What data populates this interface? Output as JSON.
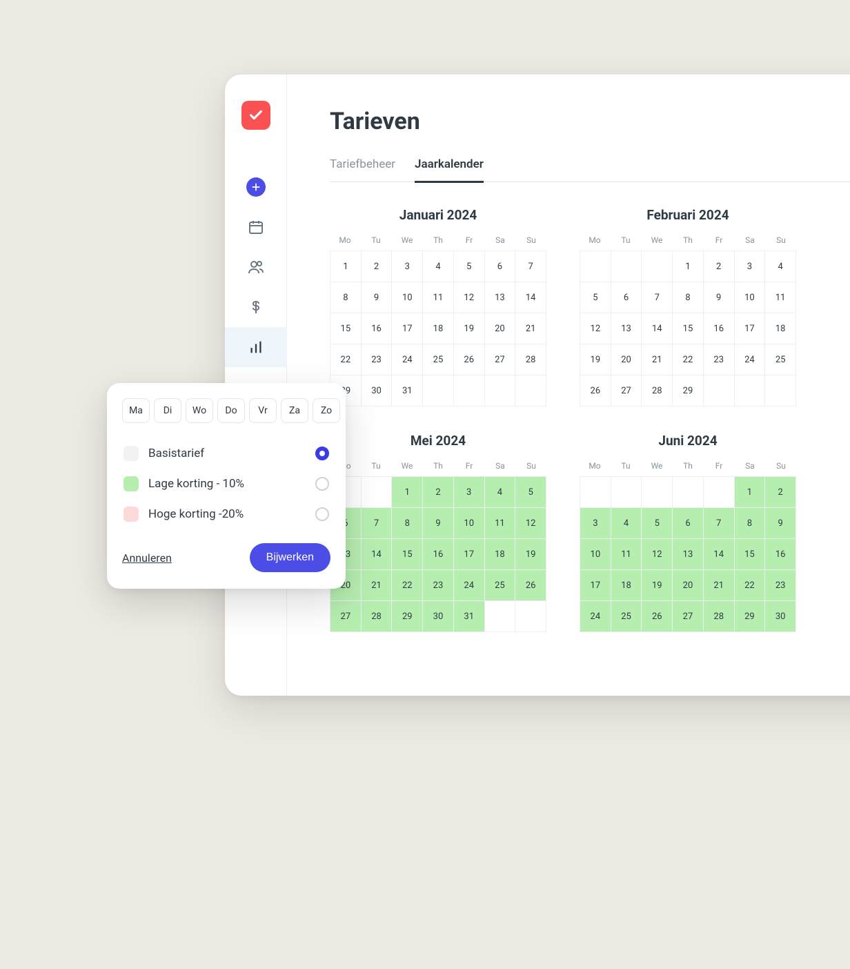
{
  "page_title": "Tarieven",
  "tabs": [
    {
      "label": "Tariefbeheer",
      "active": false
    },
    {
      "label": "Jaarkalender",
      "active": true
    }
  ],
  "weekday_short": [
    "Mo",
    "Tu",
    "We",
    "Th",
    "Fr",
    "Sa",
    "Su"
  ],
  "months": {
    "jan": {
      "title": "Januari 2024",
      "lead_blanks": 0,
      "days": 31,
      "green_from": 0
    },
    "feb": {
      "title": "Februari 2024",
      "lead_blanks": 3,
      "days": 29,
      "green_from": 0
    },
    "mei": {
      "title": "Mei 2024",
      "lead_blanks": 2,
      "days": 31,
      "green_from": 1
    },
    "juni": {
      "title": "Juni 2024",
      "lead_blanks": 5,
      "days": 30,
      "green_from": 1
    }
  },
  "popup": {
    "day_buttons": [
      "Ma",
      "Di",
      "Wo",
      "Do",
      "Vr",
      "Za",
      "Zo"
    ],
    "options": [
      {
        "label": "Basistarief",
        "swatch": "#f3f2f2",
        "selected": true
      },
      {
        "label": "Lage korting - 10%",
        "swatch": "#b6eeb0",
        "selected": false
      },
      {
        "label": "Hoge korting -20%",
        "swatch": "#fcdada",
        "selected": false
      }
    ],
    "cancel": "Annuleren",
    "submit": "Bijwerken"
  }
}
